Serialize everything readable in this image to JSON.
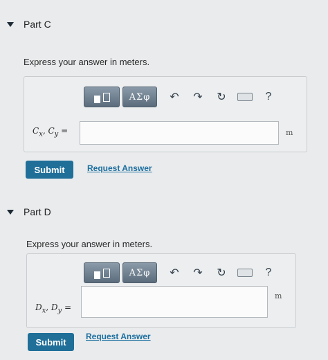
{
  "part_c": {
    "title": "Part C",
    "prompt": "Express your answer in meters.",
    "toolbar": {
      "symbols": "ΑΣφ",
      "help": "?"
    },
    "variable_label": "Cx, Cy =",
    "var1": "C",
    "sub1": "x",
    "var2": "C",
    "sub2": "y",
    "input_value": "",
    "unit": "m",
    "submit_label": "Submit",
    "request_label": "Request Answer"
  },
  "part_d": {
    "title": "Part D",
    "prompt": "Express your answer in meters.",
    "toolbar": {
      "symbols": "ΑΣφ",
      "help": "?"
    },
    "var1": "D",
    "sub1": "x",
    "var2": "D",
    "sub2": "y",
    "input_value": "",
    "unit": "m",
    "submit_label": "Submit",
    "request_label": "Request Answer"
  },
  "icons": [
    "caret-down-icon",
    "template-icon",
    "undo-icon",
    "redo-icon",
    "reset-icon",
    "keyboard-icon",
    "help-icon"
  ]
}
